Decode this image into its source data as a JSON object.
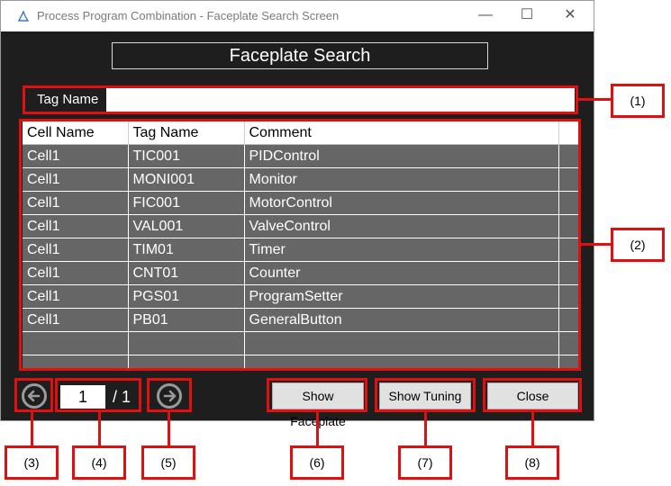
{
  "window": {
    "title": "Process Program Combination - Faceplate Search Screen",
    "controls": {
      "minimize": "—",
      "maximize": "☐",
      "close": "✕"
    }
  },
  "header": {
    "title": "Faceplate Search"
  },
  "search": {
    "label": "Tag Name",
    "value": ""
  },
  "table": {
    "columns": [
      "Cell Name",
      "Tag Name",
      "Comment"
    ],
    "rows": [
      [
        "Cell1",
        "TIC001",
        "PIDControl"
      ],
      [
        "Cell1",
        "MONI001",
        "Monitor"
      ],
      [
        "Cell1",
        "FIC001",
        "MotorControl"
      ],
      [
        "Cell1",
        "VAL001",
        "ValveControl"
      ],
      [
        "Cell1",
        "TIM01",
        "Timer"
      ],
      [
        "Cell1",
        "CNT01",
        "Counter"
      ],
      [
        "Cell1",
        "PGS01",
        "ProgramSetter"
      ],
      [
        "Cell1",
        "PB01",
        "GeneralButton"
      ],
      [
        "",
        "",
        ""
      ],
      [
        "",
        "",
        ""
      ]
    ]
  },
  "pager": {
    "current": "1",
    "total": "/ 1"
  },
  "buttons": {
    "show_faceplate": "Show Faceplate",
    "show_tuning": "Show Tuning",
    "close": "Close"
  },
  "annotations": {
    "c1": "(1)",
    "c2": "(2)",
    "c3": "(3)",
    "c4": "(4)",
    "c5": "(5)",
    "c6": "(6)",
    "c7": "(7)",
    "c8": "(8)"
  },
  "colors": {
    "highlight": "#e01010",
    "window_bg": "#1e1e1e",
    "grid_bg": "#666666"
  },
  "icons": {
    "prev": "arrow-left-circle-icon",
    "next": "arrow-right-circle-icon"
  }
}
